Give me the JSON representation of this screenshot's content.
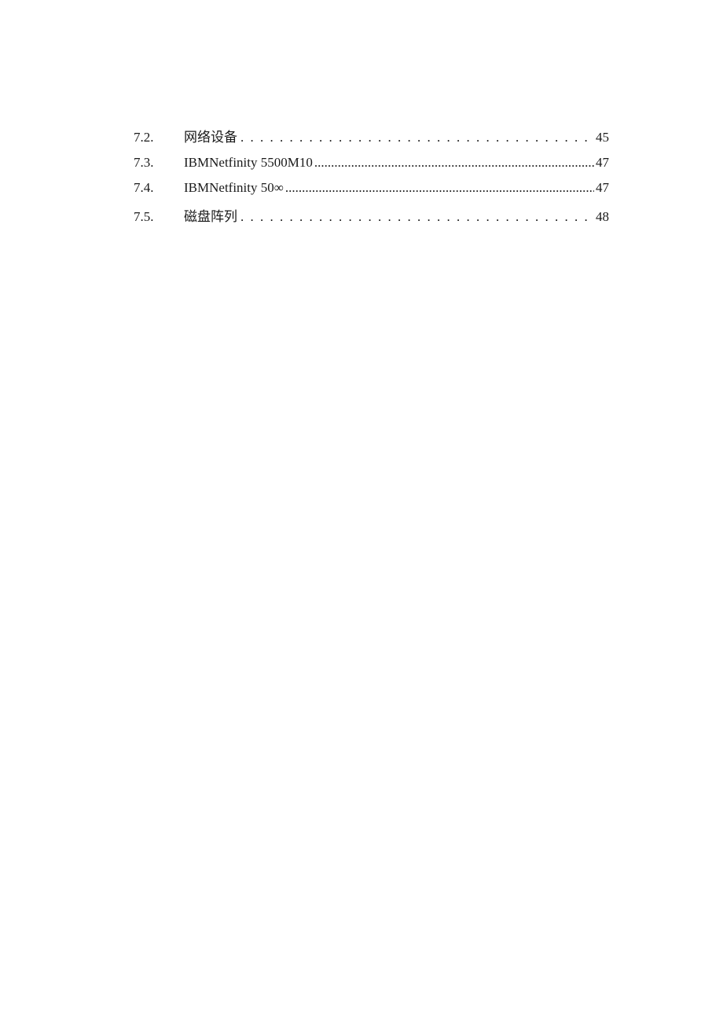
{
  "toc": {
    "entries": [
      {
        "number": "7.2.",
        "title": "网络设备",
        "page": "45",
        "leader": "spaced",
        "cjk": true
      },
      {
        "number": "7.3.",
        "title": "IBMNetfinity   5500M10",
        "page": "47",
        "leader": "dense",
        "cjk": false
      },
      {
        "number": "7.4.",
        "title": "IBMNetfinity   50∞",
        "page": "47",
        "leader": "dense",
        "cjk": false
      },
      {
        "number": "7.5.",
        "title": "磁盘阵列",
        "page": "48",
        "leader": "spaced",
        "cjk": true
      }
    ]
  }
}
